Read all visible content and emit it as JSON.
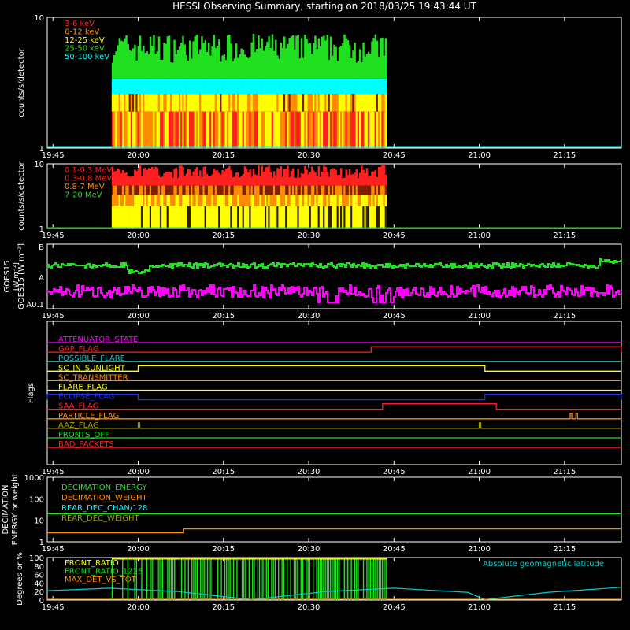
{
  "title": "HESSI Observing Summary, starting on 2018/03/25 19:43:44 UT",
  "colors": {
    "background": "#000000",
    "axes": "#ffffff",
    "red": "#ff2020",
    "orange": "#ff8c00",
    "yellow": "#ffff00",
    "green": "#20e020",
    "cyan": "#00ffff",
    "magenta": "#ff00ff",
    "blue": "#2030ff",
    "olive": "#a0a000"
  },
  "chart_data": [
    {
      "id": "panel1",
      "type": "bar",
      "ylabel": "counts/s/detector",
      "yscale": "log",
      "ylim": [
        1,
        10
      ],
      "ytick_labels": [
        "1",
        "10"
      ],
      "xlim_minutes": [
        -1,
        99
      ],
      "xtick_labels": [
        "19:45",
        "20:00",
        "20:15",
        "20:30",
        "20:45",
        "21:00",
        "21:15"
      ],
      "data_window": [
        "19:57",
        "20:43"
      ],
      "series": [
        {
          "name": "3-6 keV",
          "color": "#ff2020",
          "level": 1.9
        },
        {
          "name": "6-12 keV",
          "color": "#ff8c00",
          "level": 1.9
        },
        {
          "name": "12-25 keV",
          "color": "#ffff00",
          "level": 2.6
        },
        {
          "name": "25-50 keV",
          "color": "#20e020",
          "level": 5.0
        },
        {
          "name": "50-100 keV",
          "color": "#00ffff",
          "level": 3.4
        }
      ],
      "baseline_color": "#00ffff"
    },
    {
      "id": "panel2",
      "type": "bar",
      "ylabel": "counts/s/detector",
      "yscale": "log",
      "ylim": [
        1,
        10
      ],
      "ytick_labels": [
        "1",
        "10"
      ],
      "xtick_labels": [
        "19:45",
        "20:00",
        "20:15",
        "20:30",
        "20:45",
        "21:00",
        "21:15"
      ],
      "data_window": [
        "19:57",
        "20:43"
      ],
      "series": [
        {
          "name": "0.1-0.3 MeV",
          "color": "#ff2020",
          "level": 7.0
        },
        {
          "name": "0.3-0.8 MeV",
          "color": "#ff2020",
          "level": 5.0
        },
        {
          "name": "0.8-7 MeV",
          "color": "#ff8c00",
          "level": 3.5
        },
        {
          "name": "7-20 MeV",
          "color": "#20e020",
          "level": 1.0
        }
      ],
      "baseline_color": "#20e020"
    },
    {
      "id": "panel3",
      "type": "line",
      "ylabel": "GOES15 [W m⁻²]",
      "ytick_labels": [
        "B",
        "A",
        "A0.1"
      ],
      "xtick_labels": [
        "19:45",
        "20:00",
        "20:15",
        "20:30",
        "20:45",
        "21:00",
        "21:15"
      ],
      "series": [
        {
          "name": "",
          "color": "#20e020",
          "level": 0.75
        },
        {
          "name": "",
          "color": "#ff00ff",
          "level": 0.35
        }
      ]
    },
    {
      "id": "panel4",
      "type": "line",
      "ylabel": "Flags",
      "xtick_labels": [
        "19:45",
        "20:00",
        "20:15",
        "20:30",
        "20:45",
        "21:00",
        "21:15"
      ],
      "flags": [
        {
          "name": "ATTENUATOR_STATE",
          "color": "#ff00ff",
          "segments": []
        },
        {
          "name": "GAP_FLAG",
          "color": "#ff2020",
          "segments": [
            [
              "20:41",
              "21:25"
            ]
          ]
        },
        {
          "name": "POSSIBLE_FLARE",
          "color": "#00cccc",
          "segments": []
        },
        {
          "name": "SC_IN_SUNLIGHT",
          "color": "#ffff00",
          "segments": [
            [
              "20:00",
              "21:01"
            ]
          ]
        },
        {
          "name": "SC_TRANSMITTER",
          "color": "#ff8c00",
          "segments": []
        },
        {
          "name": "FLARE_FLAG",
          "color": "#ffff00",
          "segments": []
        },
        {
          "name": "ECLIPSE_FLAG",
          "color": "#2030ff",
          "segments": [
            [
              "19:44",
              "20:00"
            ],
            [
              "21:01",
              "21:25"
            ]
          ]
        },
        {
          "name": "SAA_FLAG",
          "color": "#ff2020",
          "segments": [
            [
              "20:43",
              "21:03"
            ]
          ]
        },
        {
          "name": "PARTICLE_FLAG",
          "color": "#ff8c00",
          "segments": [
            [
              "21:16",
              "21:16"
            ],
            [
              "21:17",
              "21:17"
            ]
          ]
        },
        {
          "name": "AAZ_FLAG",
          "color": "#a0a000",
          "segments": [
            [
              "20:00",
              "20:00"
            ],
            [
              "21:00",
              "21:00"
            ]
          ]
        },
        {
          "name": "FRONTS_OFF",
          "color": "#20e020",
          "segments": []
        },
        {
          "name": "BAD_PACKETS",
          "color": "#ff2020",
          "segments": []
        }
      ]
    },
    {
      "id": "panel5",
      "type": "line",
      "ylabel": "DECIMATION ENERGY or weight",
      "yscale": "log",
      "ylim": [
        1,
        1000
      ],
      "ytick_labels": [
        "1",
        "10",
        "100",
        "1000"
      ],
      "xtick_labels": [
        "19:45",
        "20:00",
        "20:15",
        "20:30",
        "20:45",
        "21:00",
        "21:15"
      ],
      "series": [
        {
          "name": "DECIMATION_ENERGY",
          "color": "#20e020",
          "values": [
            [
              "19:44",
              20
            ],
            [
              "21:25",
              20
            ]
          ]
        },
        {
          "name": "DECIMATION_WEIGHT",
          "color": "#ff8c00",
          "values": [
            [
              "19:44",
              2.6
            ],
            [
              "20:08",
              2.6
            ],
            [
              "20:08",
              4
            ],
            [
              "21:25",
              4
            ]
          ]
        },
        {
          "name": "REAR_DEC_CHAN/128",
          "color": "#00ffff",
          "values": []
        },
        {
          "name": "REAR_DEC_WEIGHT",
          "color": "#a0a000",
          "values": []
        }
      ]
    },
    {
      "id": "panel6",
      "type": "line",
      "ylabel": "Degrees or %",
      "ylim": [
        0,
        100
      ],
      "ytick_labels": [
        "0",
        "20",
        "40",
        "60",
        "80",
        "100"
      ],
      "xtick_labels": [
        "19:45",
        "20:00",
        "20:15",
        "20:30",
        "20:45",
        "21:00",
        "21:15"
      ],
      "series": [
        {
          "name": "FRONT_RATIO",
          "color": "#ffff00",
          "level": 98
        },
        {
          "name": "FRONT_RATIO_1225",
          "color": "#20e020",
          "level": 96
        },
        {
          "name": "MAX_DET_VS_TOT",
          "color": "#ff8c00",
          "level": 0
        },
        {
          "name": "Absolute geomagnetic latitude",
          "color": "#00cccc",
          "values": [
            [
              "19:44",
              22
            ],
            [
              "19:55",
              28
            ],
            [
              "20:07",
              20
            ],
            [
              "20:20",
              1
            ],
            [
              "20:33",
              20
            ],
            [
              "20:45",
              28
            ],
            [
              "20:58",
              18
            ],
            [
              "21:01",
              1
            ],
            [
              "21:12",
              18
            ],
            [
              "21:25",
              30
            ]
          ]
        }
      ]
    }
  ]
}
